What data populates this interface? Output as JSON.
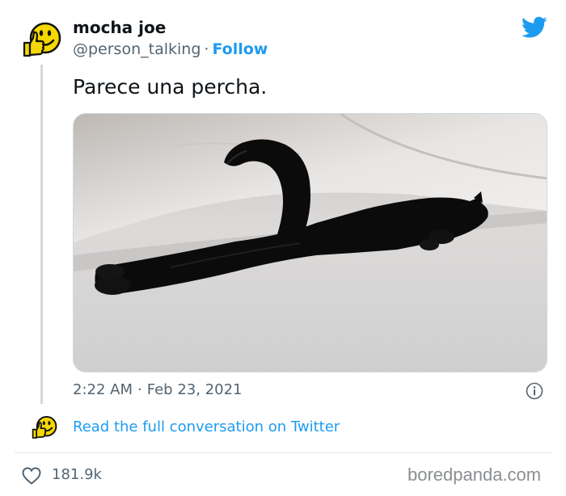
{
  "tweet": {
    "author_name": "mocha joe",
    "handle": "@person_talking",
    "separator": "·",
    "follow_label": "Follow",
    "text": "Parece una percha.",
    "time": "2:22 AM",
    "date": "Feb 23, 2021",
    "read_more": "Read the full conversation on Twitter",
    "likes": "181.9k"
  },
  "icons": {
    "avatar": "thumbs-up-smiley-icon",
    "brand": "twitter-bird-icon",
    "info": "info-icon",
    "like": "heart-icon"
  },
  "colors": {
    "accent": "#1d9bf0",
    "secondary_text": "#536471",
    "avatar_yellow": "#f4d800"
  },
  "watermark": "boredpanda.com"
}
